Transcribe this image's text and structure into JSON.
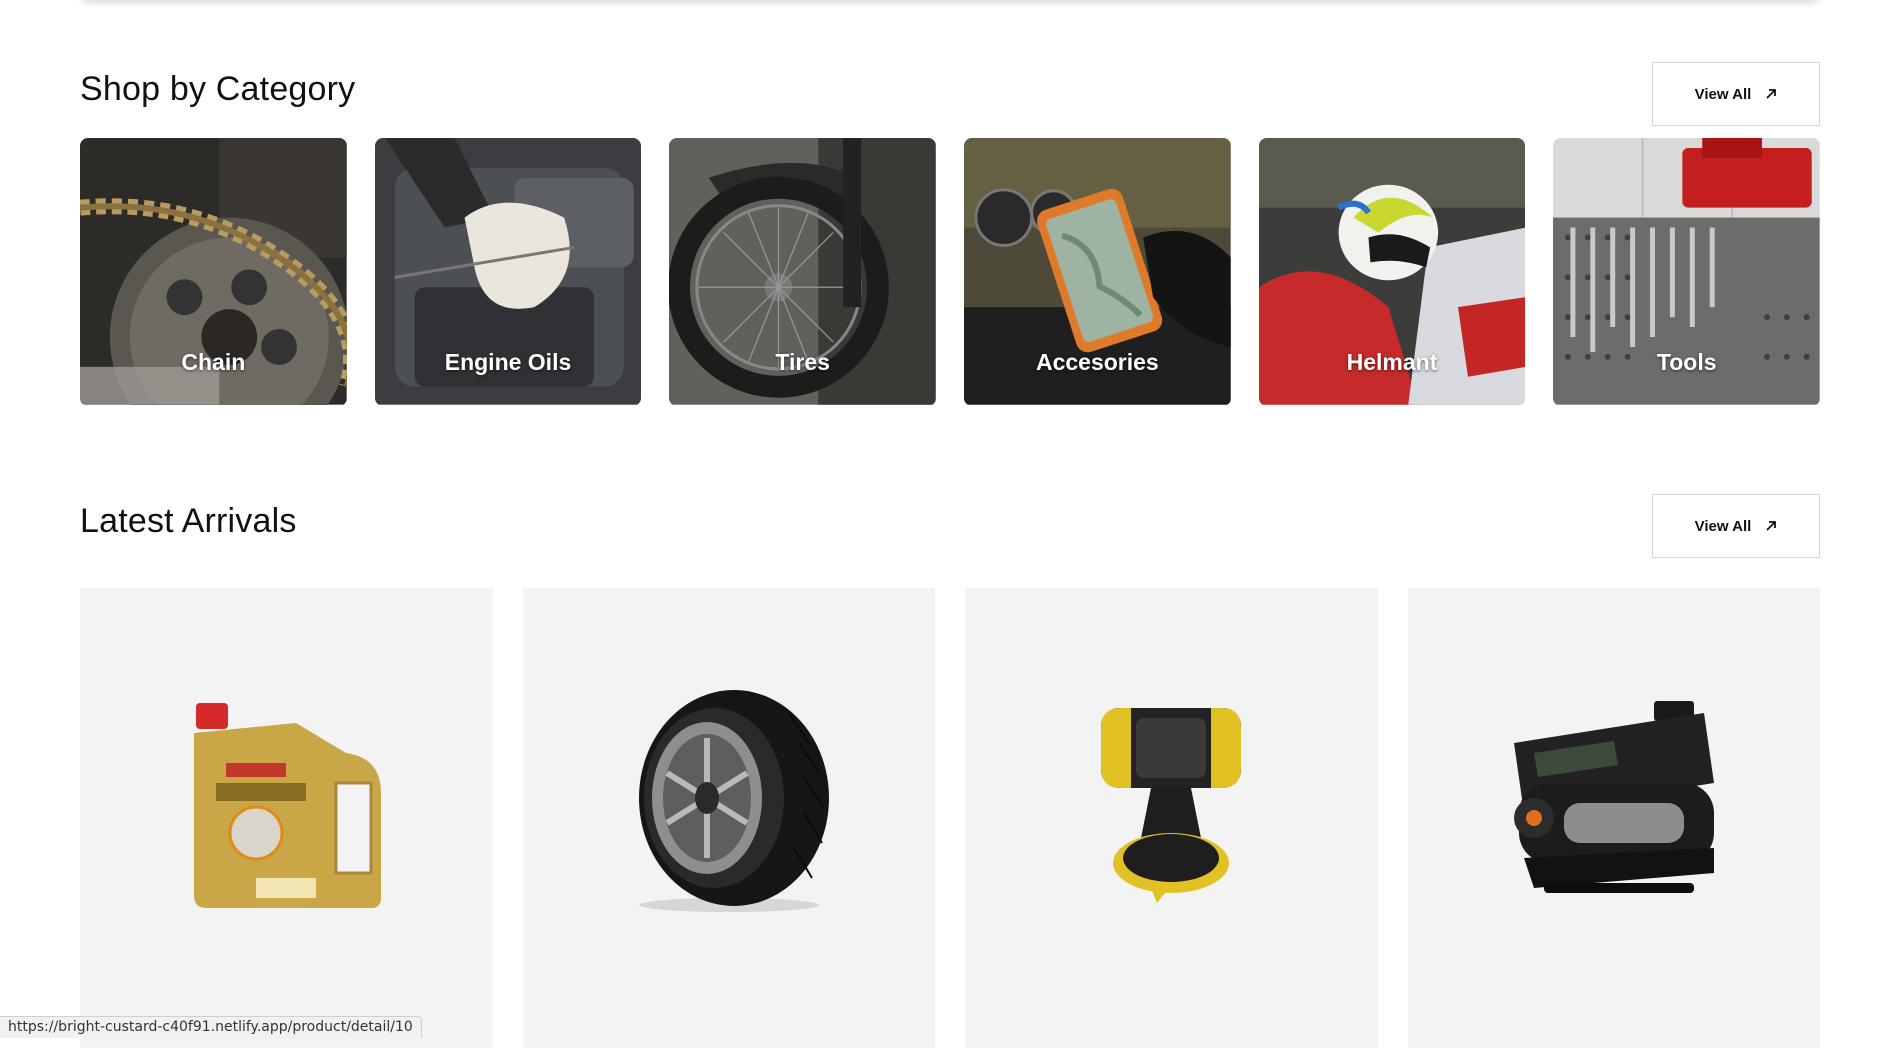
{
  "category_section": {
    "title": "Shop by Category",
    "view_all": "View All",
    "items": [
      {
        "label": "Chain",
        "icon": "chain-photo"
      },
      {
        "label": "Engine Oils",
        "icon": "engine-oil-photo"
      },
      {
        "label": "Tires",
        "icon": "tire-photo"
      },
      {
        "label": "Accesories",
        "icon": "phone-mount-photo"
      },
      {
        "label": "Helmant",
        "icon": "helmet-photo"
      },
      {
        "label": "Tools",
        "icon": "tools-photo"
      }
    ]
  },
  "arrivals_section": {
    "title": "Latest Arrivals",
    "view_all": "View All",
    "products": [
      {
        "icon": "castrol-edge-oil-can"
      },
      {
        "icon": "car-tire"
      },
      {
        "icon": "phone-holder"
      },
      {
        "icon": "air-compressor"
      }
    ]
  },
  "status_bar": {
    "url": "https://bright-custard-c40f91.netlify.app/product/detail/10"
  }
}
